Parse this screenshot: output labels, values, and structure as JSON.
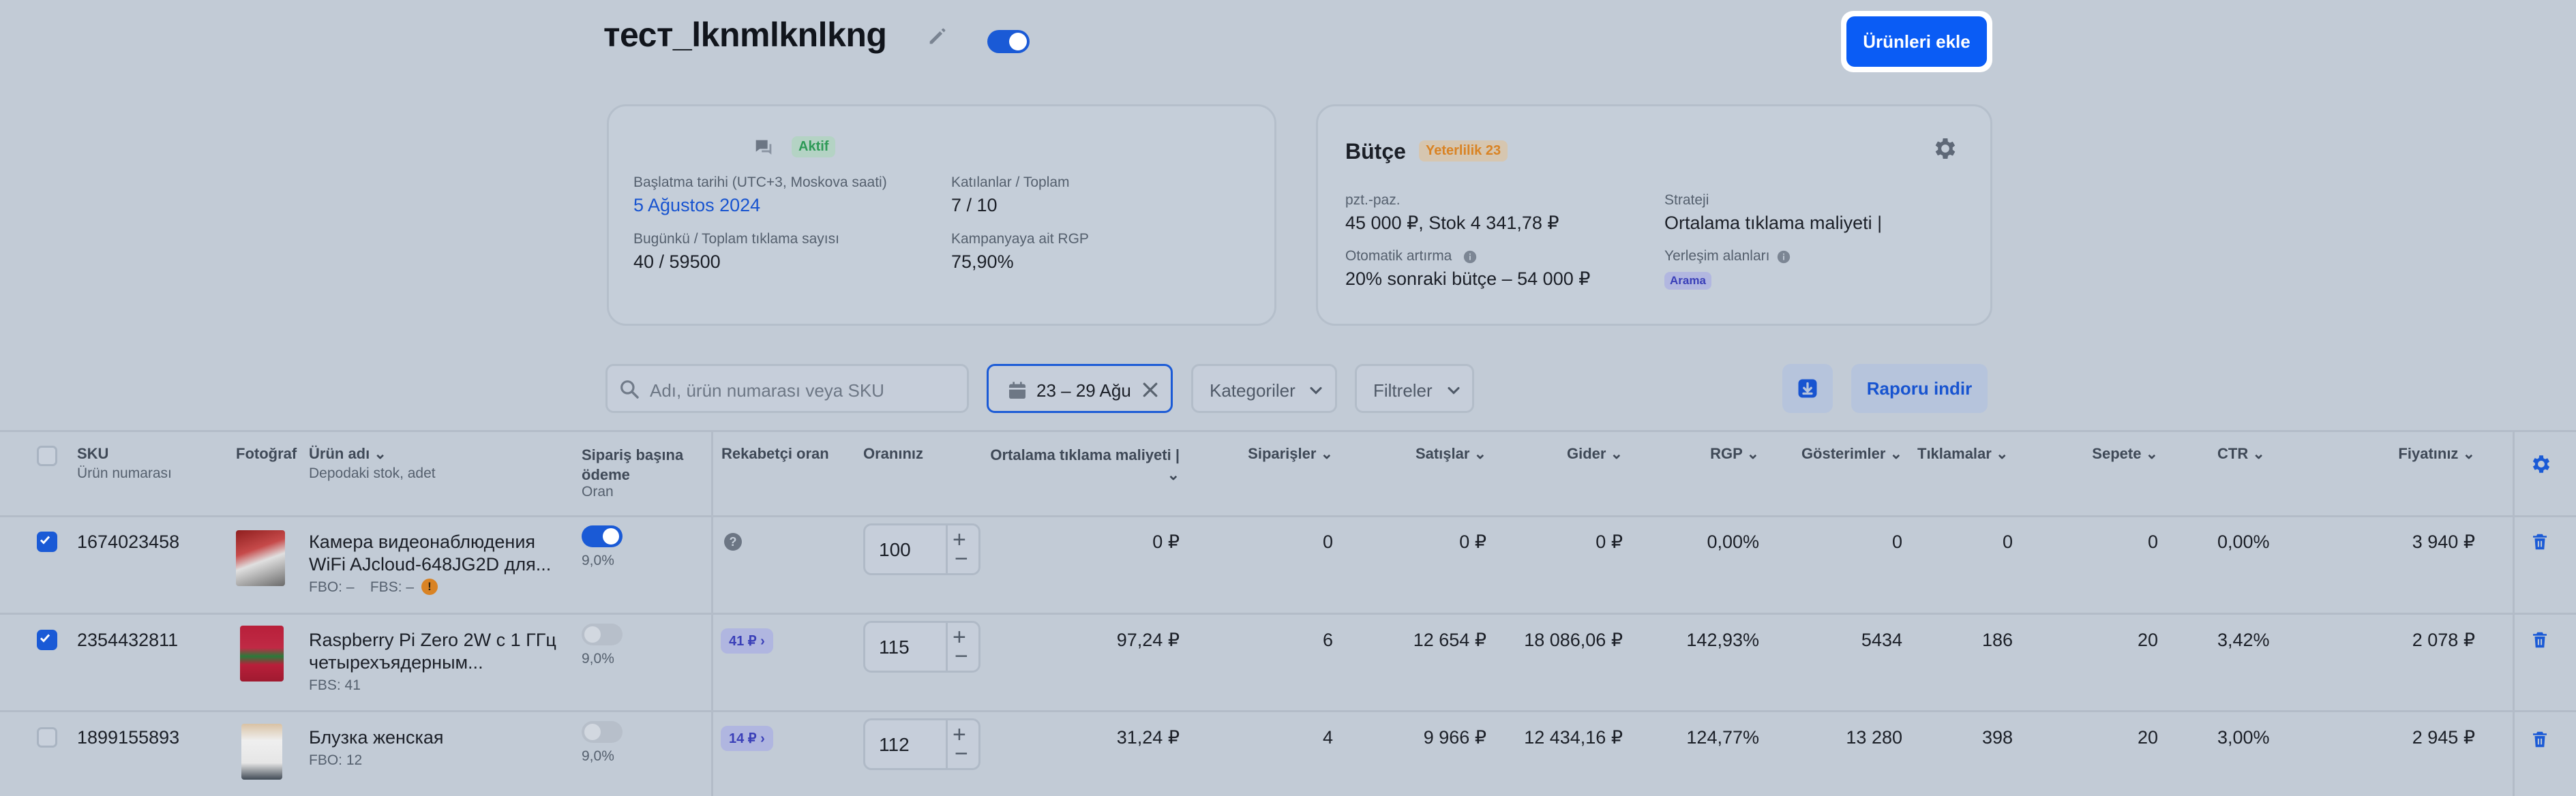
{
  "header": {
    "title": "тест_lknmlknlkng",
    "add_button": "Ürünleri ekle"
  },
  "campaign_card": {
    "status": "Aktif",
    "start_label": "Başlatma tarihi (UTC+3, Moskova saati)",
    "start_value": "5 Ağustos 2024",
    "participants_label": "Katılanlar / Toplam",
    "participants_value": "7 / 10",
    "clicks_label": "Bugünkü / Toplam tıklama sayısı",
    "clicks_value": "40 / 59500",
    "rgp_label": "Kampanyaya ait RGP",
    "rgp_value": "75,90%"
  },
  "budget_card": {
    "title": "Bütçe",
    "badge": "Yeterlilik 23",
    "schedule_label": "pzt.-paz.",
    "schedule_value": "45 000 ₽, Stok 4 341,78 ₽",
    "strategy_label": "Strateji",
    "strategy_value": "Ortalama tıklama maliyeti |",
    "auto_label": "Otomatik artırma",
    "auto_value": "20% sonraki bütçe – 54 000 ₽",
    "placement_label": "Yerleşim alanları",
    "placement_tag": "Arama"
  },
  "toolbar": {
    "search_placeholder": "Adı, ürün numarası veya SKU",
    "date_range": "23 – 29 Ağu",
    "categories": "Kategoriler",
    "filters": "Filtreler",
    "report_button": "Raporu indir"
  },
  "table": {
    "headers": {
      "sku": "SKU",
      "sku_sub": "Ürün numarası",
      "photo": "Fotoğraf",
      "name": "Ürün adı",
      "name_sub": "Depodaki stok, adet",
      "pay": "Sipariş başına ödeme",
      "pay_sub": "Oran",
      "competitor": "Rekabetçi oran",
      "rate": "Oranınız",
      "avg_click": "Ortalama tıklama maliyeti |",
      "orders": "Siparişler",
      "sales": "Satışlar",
      "expenses": "Gider",
      "rgp": "RGP",
      "impressions": "Gösterimler",
      "clicks": "Tıklamalar",
      "cart": "Sepete",
      "ctr": "CTR",
      "price": "Fiyatınız"
    },
    "rows": [
      {
        "sku": "1674023458",
        "name_line1": "Камера видеонаблюдения",
        "name_line2": "WiFi AJcloud-648JG2D для...",
        "stock": "FBO: –    FBS: –",
        "pay_rate": "9,0%",
        "competitor": "",
        "rate": "100",
        "avg_click": "0 ₽",
        "orders": "0",
        "sales": "0 ₽",
        "expenses": "0 ₽",
        "rgp": "0,00%",
        "impressions": "0",
        "clicks": "0",
        "cart": "0",
        "ctr": "0,00%",
        "price": "3 940 ₽",
        "checked": true,
        "toggle_on": true
      },
      {
        "sku": "2354432811",
        "name_line1": "Raspberry Pi Zero 2W с 1 ГГц",
        "name_line2": "четырехъядерным...",
        "stock": "FBS: 41",
        "pay_rate": "9,0%",
        "competitor": "41 ₽",
        "rate": "115",
        "avg_click": "97,24 ₽",
        "orders": "6",
        "sales": "12 654 ₽",
        "expenses": "18 086,06 ₽",
        "rgp": "142,93%",
        "impressions": "5434",
        "clicks": "186",
        "cart": "20",
        "ctr": "3,42%",
        "price": "2 078 ₽",
        "checked": true,
        "toggle_on": false
      },
      {
        "sku": "1899155893",
        "name_line1": "Блузка женская",
        "name_line2": "",
        "stock": "FBO: 12",
        "pay_rate": "9,0%",
        "competitor": "14 ₽",
        "rate": "112",
        "avg_click": "31,24 ₽",
        "orders": "4",
        "sales": "9 966 ₽",
        "expenses": "12 434,16 ₽",
        "rgp": "124,77%",
        "impressions": "13 280",
        "clicks": "398",
        "cart": "20",
        "ctr": "3,00%",
        "price": "2 945 ₽",
        "checked": false,
        "toggle_on": false
      }
    ]
  },
  "colors": {
    "accent": "#0a5cf5",
    "page_bg": "#c2cbd6",
    "status_green": "#2e9a57",
    "warning_orange": "#d98324"
  }
}
